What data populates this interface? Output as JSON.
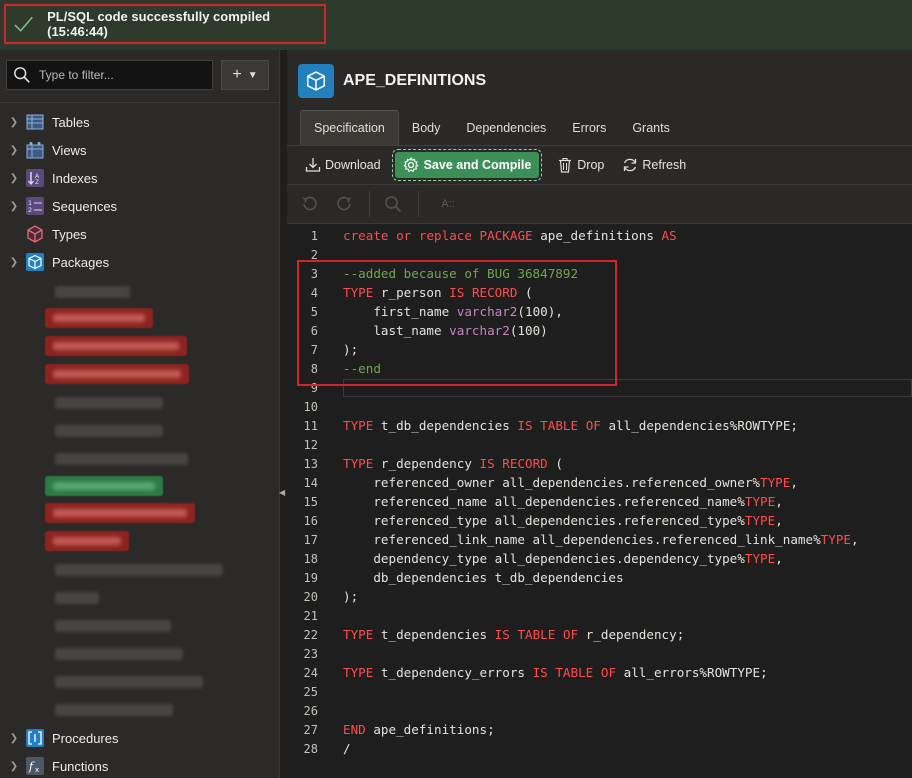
{
  "notification": {
    "message": "PL/SQL code successfully compiled (15:46:44)"
  },
  "sidebar": {
    "filter_placeholder": "Type to filter...",
    "add_label": "+",
    "items": [
      {
        "label": "Tables",
        "color": "#6c8ebf"
      },
      {
        "label": "Views",
        "color": "#6c8ebf"
      },
      {
        "label": "Indexes",
        "color": "#8a6fbf"
      },
      {
        "label": "Sequences",
        "color": "#8a6fbf"
      },
      {
        "label": "Types",
        "color": "#c0556b"
      },
      {
        "label": "Packages",
        "color": "#2280bf"
      },
      {
        "label": "Procedures",
        "color": "#2280bf"
      },
      {
        "label": "Functions",
        "color": "#6c7a89"
      }
    ]
  },
  "object": {
    "title": "APE_DEFINITIONS"
  },
  "tabs": [
    {
      "label": "Specification"
    },
    {
      "label": "Body"
    },
    {
      "label": "Dependencies"
    },
    {
      "label": "Errors"
    },
    {
      "label": "Grants"
    }
  ],
  "toolbar": {
    "download": "Download",
    "save_compile": "Save and Compile",
    "drop": "Drop",
    "refresh": "Refresh"
  },
  "editor": {
    "font_size_glyph": "A::",
    "line_numbers": [
      "1",
      "2",
      "3",
      "4",
      "5",
      "6",
      "7",
      "8",
      "9",
      "10",
      "11",
      "12",
      "13",
      "14",
      "15",
      "16",
      "17",
      "18",
      "19",
      "20",
      "21",
      "22",
      "23",
      "24",
      "25",
      "26",
      "27",
      "28"
    ]
  },
  "colors": {
    "accent": "#2280bf",
    "success": "#3b8f57",
    "highlight_border": "#d0262b",
    "keyword": "#ff4c4c",
    "comment": "#6aa84f"
  }
}
